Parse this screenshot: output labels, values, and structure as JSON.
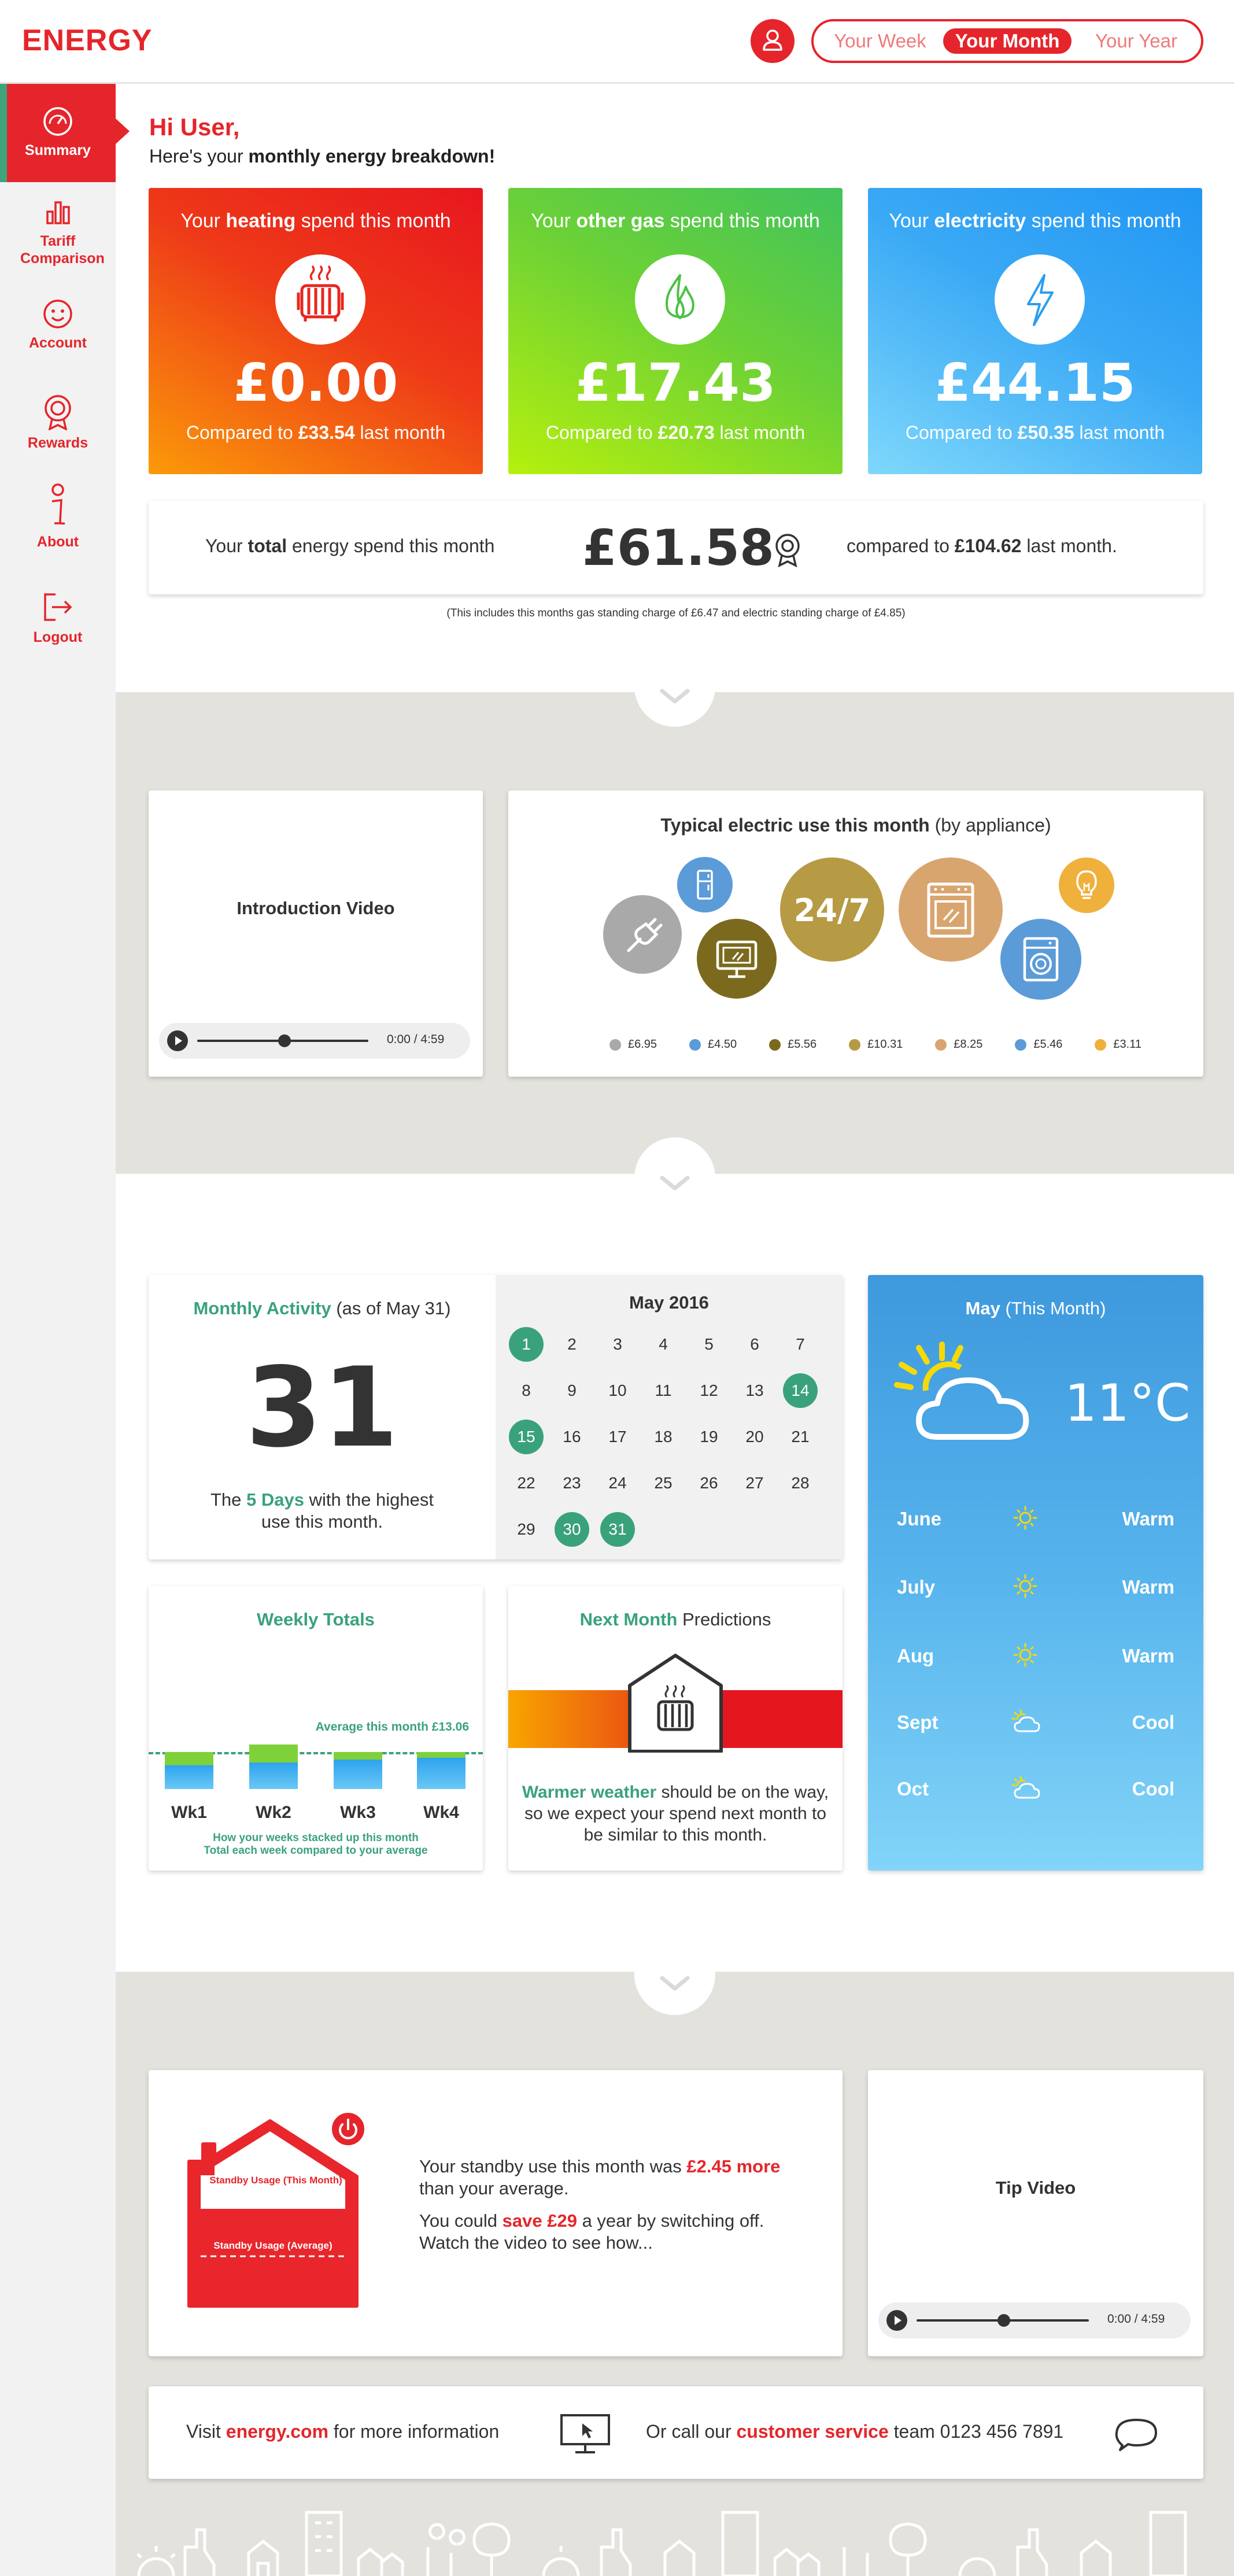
{
  "app": {
    "logo": "ENERGY"
  },
  "period_tabs": [
    "Your Week",
    "Your Month",
    "Your Year"
  ],
  "period_active": "Your Month",
  "sidebar": [
    {
      "label": "Summary",
      "icon": "gauge-icon",
      "active": true
    },
    {
      "label": "Tariff Comparison",
      "icon": "bar-chart-icon"
    },
    {
      "label": "Account",
      "icon": "smiley-icon"
    },
    {
      "label": "Rewards",
      "icon": "award-icon"
    },
    {
      "label": "About",
      "icon": "info-icon"
    },
    {
      "label": "Logout",
      "icon": "logout-icon"
    }
  ],
  "greeting": {
    "hi": "Hi User,",
    "intro": "Here's your ",
    "intro_bold": "monthly energy breakdown!"
  },
  "spend_cards": [
    {
      "pre": "Your ",
      "bold": "heating",
      "post": " spend this month",
      "amount": "£0.00",
      "cmp_pre": "Compared to ",
      "cmp_bold": "£33.54",
      "cmp_post": " last month",
      "icon": "radiator-icon"
    },
    {
      "pre": "Your ",
      "bold": "other gas",
      "post": " spend this month",
      "amount": "£17.43",
      "cmp_pre": "Compared to ",
      "cmp_bold": "£20.73",
      "cmp_post": " last month",
      "icon": "flame-icon"
    },
    {
      "pre": "Your ",
      "bold": "electricity",
      "post": " spend this month",
      "amount": "£44.15",
      "cmp_pre": "Compared to ",
      "cmp_bold": "£50.35",
      "cmp_post": " last month",
      "icon": "bolt-icon"
    }
  ],
  "total": {
    "pre": "Your ",
    "bold": "total",
    "post": " energy spend this month",
    "amount": "£61.58",
    "cmp_pre": "compared to ",
    "cmp_bold": "£104.62",
    "cmp_post": " last month.",
    "note": "(This includes this months gas standing charge of £6.47 and electric standing charge of £4.85)"
  },
  "intro_video": {
    "title": "Introduction Video",
    "time": "0:00",
    "sep": "/",
    "duration": "4:59"
  },
  "appliance": {
    "title_bold": "Typical electric use this month",
    "title_rest": " (by appliance)",
    "center_label": "24/7",
    "legend": [
      {
        "value": "£6.95",
        "color": "#a9a9a9"
      },
      {
        "value": "£4.50",
        "color": "#5b9bd8"
      },
      {
        "value": "£5.56",
        "color": "#7b6a1e"
      },
      {
        "value": "£10.31",
        "color": "#b69a44"
      },
      {
        "value": "£8.25",
        "color": "#d9a56e"
      },
      {
        "value": "£5.46",
        "color": "#5b9bd8"
      },
      {
        "value": "£3.11",
        "color": "#efb03c"
      }
    ]
  },
  "activity": {
    "title_green": "Monthly Activity",
    "title_rest": " (as of May 31)",
    "big": "31",
    "desc_pre": "The ",
    "desc_green": "5 Days",
    "desc_post": " with the highest use this month."
  },
  "calendar": {
    "month": "May 2016",
    "weeks": [
      [
        "1",
        "2",
        "3",
        "4",
        "5",
        "6",
        "7"
      ],
      [
        "8",
        "9",
        "10",
        "11",
        "12",
        "13",
        "14"
      ],
      [
        "15",
        "16",
        "17",
        "18",
        "19",
        "20",
        "21"
      ],
      [
        "22",
        "23",
        "24",
        "25",
        "26",
        "27",
        "28"
      ],
      [
        "29",
        "30",
        "31"
      ]
    ],
    "highlight": [
      "1",
      "14",
      "15",
      "30",
      "31"
    ]
  },
  "weather": {
    "title_bold": "May",
    "title_rest": " (This Month)",
    "temp": "11°C",
    "rows": [
      {
        "month": "June",
        "icon": "sun-icon",
        "label": "Warm"
      },
      {
        "month": "July",
        "icon": "sun-icon",
        "label": "Warm"
      },
      {
        "month": "Aug",
        "icon": "sun-icon",
        "label": "Warm"
      },
      {
        "month": "Sept",
        "icon": "cloud-sun-icon",
        "label": "Cool"
      },
      {
        "month": "Oct",
        "icon": "cloud-sun-icon",
        "label": "Cool"
      }
    ]
  },
  "weekly": {
    "title": "Weekly Totals",
    "avg": "Average this month £13.06",
    "weeks": [
      "Wk1",
      "Wk2",
      "Wk3",
      "Wk4"
    ],
    "note1": "How your weeks stacked up this month",
    "note2": "Total each week compared to your average"
  },
  "prediction": {
    "title_green": "Next Month",
    "title_rest": " Predictions",
    "text_green": "Warmer weather",
    "text_rest": " should be on the way, so we expect your spend next month to be similar to this month."
  },
  "standby": {
    "label_month": "Standby Usage (This Month)",
    "label_avg": "Standby Usage (Average)",
    "p1_pre": "Your standby use this month was ",
    "p1_red": "£2.45 more",
    "p1_post": " than your average.",
    "p2_pre": "You could ",
    "p2_red": "save £29",
    "p2_post": " a year by switching off. Watch the video to see how..."
  },
  "tip_video": {
    "title": "Tip Video",
    "time": "0:00",
    "sep": "/",
    "duration": "4:59"
  },
  "contact": {
    "visit_pre": "Visit ",
    "visit_link": "energy.com",
    "visit_post": " for more information",
    "call_pre": "Or call our ",
    "call_red": "customer service",
    "call_post": " team 0123 456 7891"
  },
  "colors": {
    "brand": "#e5252b",
    "accent_green": "#3aa27b"
  }
}
